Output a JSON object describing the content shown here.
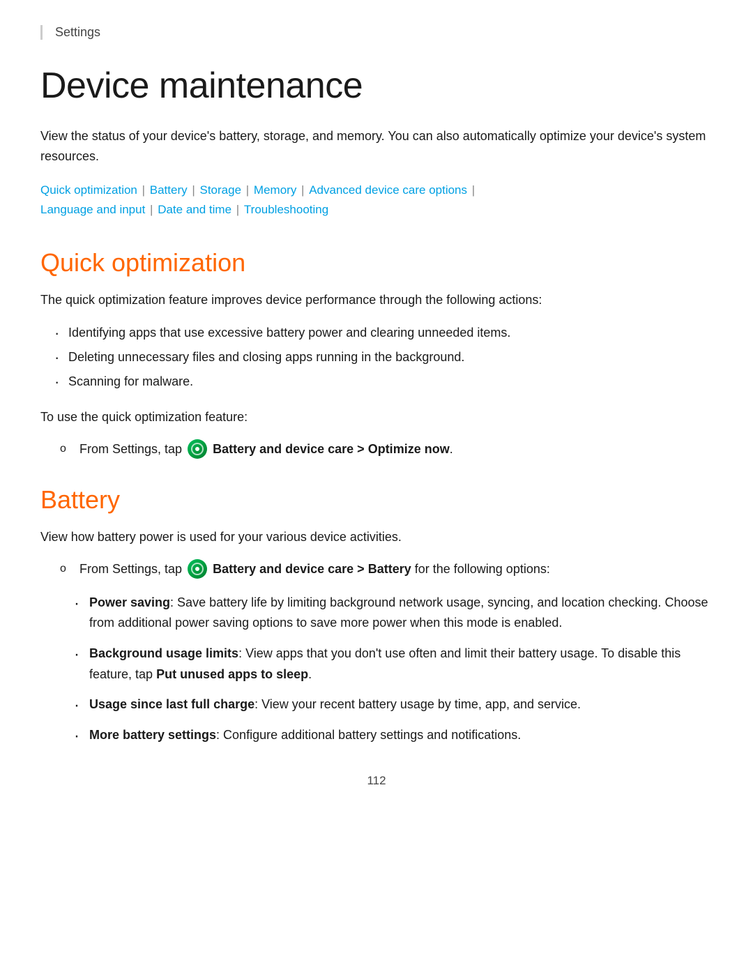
{
  "breadcrumb": {
    "label": "Settings"
  },
  "page": {
    "title": "Device maintenance",
    "intro": "View the status of your device's battery, storage, and memory. You can also automatically optimize your device's system resources.",
    "nav_links": [
      {
        "label": "Quick optimization",
        "separator": true
      },
      {
        "label": "Battery",
        "separator": true
      },
      {
        "label": "Storage",
        "separator": true
      },
      {
        "label": "Memory",
        "separator": true
      },
      {
        "label": "Advanced device care options",
        "separator": true
      },
      {
        "label": "Language and input",
        "separator": true
      },
      {
        "label": "Date and time",
        "separator": true
      },
      {
        "label": "Troubleshooting",
        "separator": false
      }
    ]
  },
  "sections": {
    "quick_optimization": {
      "title": "Quick optimization",
      "intro": "The quick optimization feature improves device performance through the following actions:",
      "bullets": [
        "Identifying apps that use excessive battery power and clearing unneeded items.",
        "Deleting unnecessary files and closing apps running in the background.",
        "Scanning for malware."
      ],
      "instruction_prefix": "To use the quick optimization feature:",
      "instruction": "From Settings, tap",
      "instruction_bold": "Battery and device care > Optimize now",
      "instruction_suffix": "."
    },
    "battery": {
      "title": "Battery",
      "intro": "View how battery power is used for your various device activities.",
      "instruction": "From Settings, tap",
      "instruction_bold": "Battery and device care > Battery",
      "instruction_suffix": "for the following options:",
      "options": [
        {
          "bold": "Power saving",
          "text": ": Save battery life by limiting background network usage, syncing, and location checking. Choose from additional power saving options to save more power when this mode is enabled."
        },
        {
          "bold": "Background usage limits",
          "text": ": View apps that you don't use often and limit their battery usage. To disable this feature, tap",
          "bold2": "Put unused apps to sleep",
          "text2": "."
        },
        {
          "bold": "Usage since last full charge",
          "text": ": View your recent battery usage by time, app, and service."
        },
        {
          "bold": "More battery settings",
          "text": ": Configure additional battery settings and notifications."
        }
      ]
    }
  },
  "page_number": "112"
}
